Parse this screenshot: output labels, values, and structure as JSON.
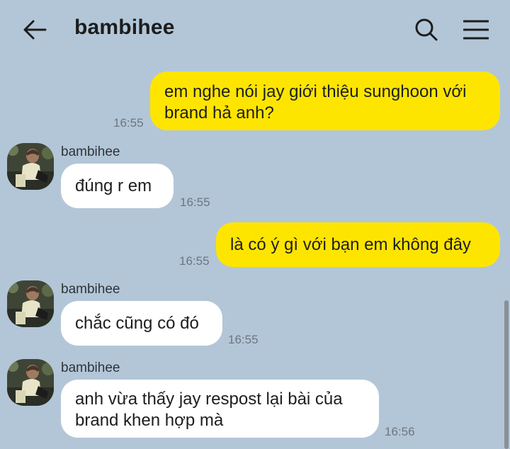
{
  "header": {
    "title": "bambihee",
    "back_icon": "arrow-left-icon",
    "search_icon": "search-icon",
    "menu_icon": "hamburger-menu-icon"
  },
  "colors": {
    "background": "#b3c6d8",
    "my_bubble": "#fee500",
    "their_bubble": "#ffffff"
  },
  "messages": [
    {
      "from": "me",
      "lines": [
        "em nghe nói jay giới thiệu sunghoon với",
        "brand hả anh?"
      ],
      "time": "16:55"
    },
    {
      "from": "bambihee",
      "sender": "bambihee",
      "lines": [
        "đúng r em"
      ],
      "time": "16:55"
    },
    {
      "from": "me",
      "lines": [
        "là có ý gì với bạn em không đây"
      ],
      "time": "16:55"
    },
    {
      "from": "bambihee",
      "sender": "bambihee",
      "lines": [
        "chắc cũng có đó"
      ],
      "time": "16:55"
    },
    {
      "from": "bambihee",
      "sender": "bambihee",
      "lines": [
        "anh vừa thấy jay respost lại bài của",
        "brand khen hợp mà"
      ],
      "time": "16:56"
    }
  ]
}
